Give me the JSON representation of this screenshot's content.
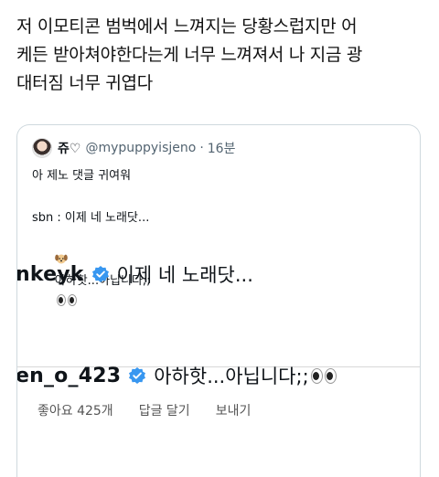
{
  "tweet": {
    "lines": [
      "저 이모티콘 범벅에서 느껴지는 당황스럽지만 어",
      "케든 받아쳐야한다는게 너무 느껴져서 나 지금 광",
      "대터짐 너무 귀엽다"
    ]
  },
  "quote": {
    "display_name": "쥬♡",
    "handle": "@mypuppyisjeno",
    "separator": "·",
    "time": "16분",
    "body_line1": "아 제노 댓글 귀여워",
    "body_line3": "sbn : 이제 네 노래닷...",
    "body_line4": "아하핫...아닙니다;;"
  },
  "comments": [
    {
      "username": "nkeyk",
      "text": "이제 네 노래닷..."
    },
    {
      "username": "en_o_423",
      "text": "아하핫...아닙니다;;"
    }
  ],
  "actions": {
    "likes": "좋아요 425개",
    "reply": "답글 달기",
    "send": "보내기"
  },
  "icons": [
    "verified-badge-icon",
    "puppy-emoji-icon",
    "eyes-emoji-icon"
  ],
  "colors": {
    "verified": "#3897f0",
    "handle": "#536471",
    "border": "#cfd9de"
  }
}
